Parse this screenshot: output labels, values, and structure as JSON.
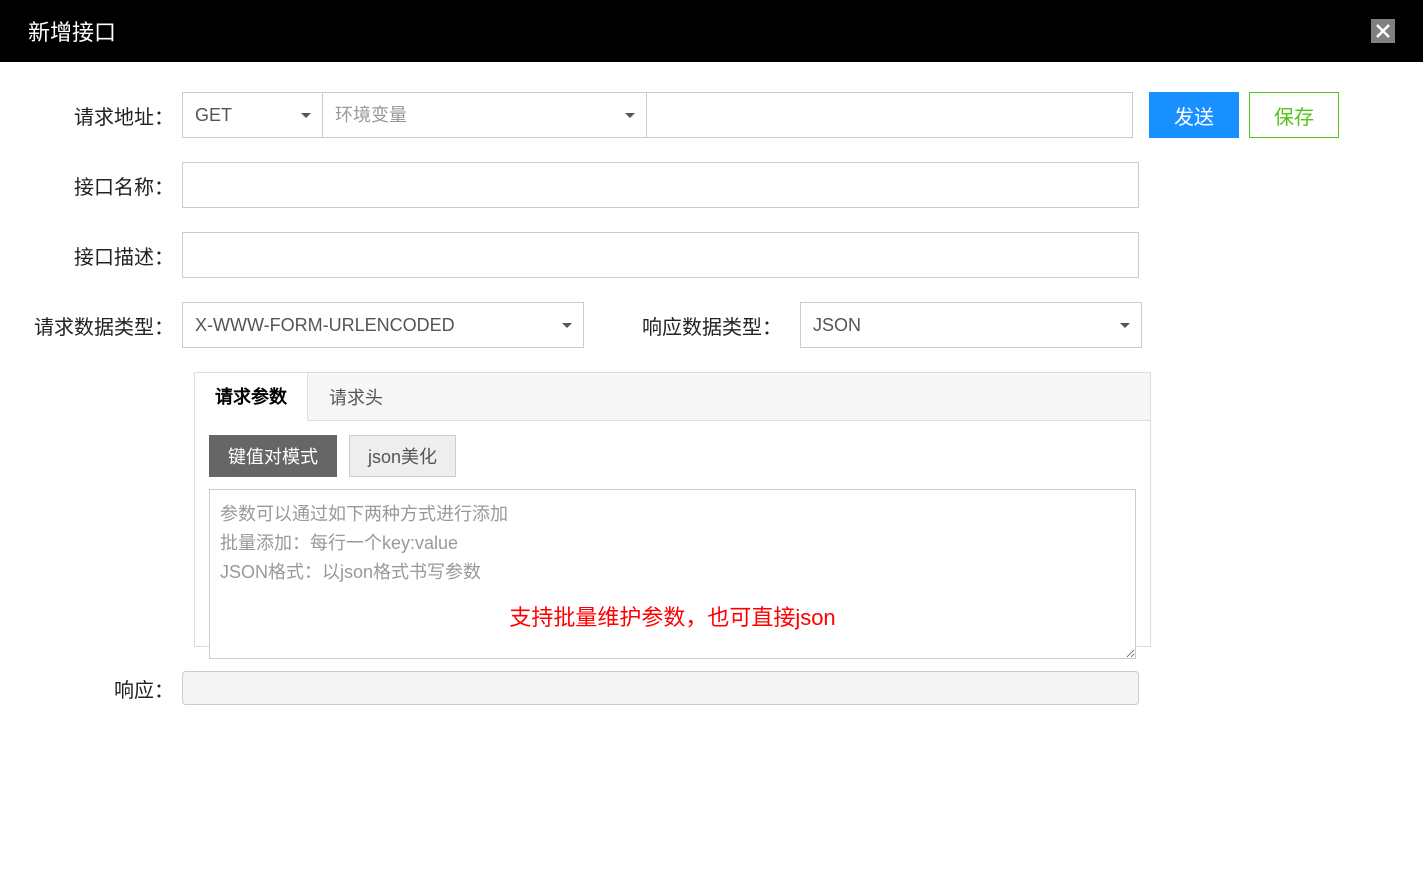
{
  "header": {
    "title": "新增接口"
  },
  "form": {
    "request_url_label": "请求地址：",
    "method_value": "GET",
    "env_placeholder": "环境变量",
    "url_value": "",
    "send_label": "发送",
    "save_label": "保存",
    "api_name_label": "接口名称：",
    "api_name_value": "",
    "api_desc_label": "接口描述：",
    "api_desc_value": "",
    "req_data_type_label": "请求数据类型：",
    "req_data_type_value": "X-WWW-FORM-URLENCODED",
    "res_data_type_label": "响应数据类型：",
    "res_data_type_value": "JSON"
  },
  "tabs": {
    "params_label": "请求参数",
    "headers_label": "请求头"
  },
  "param_modes": {
    "kv_label": "键值对模式",
    "json_beautify_label": "json美化"
  },
  "param_textarea": {
    "placeholder": "参数可以通过如下两种方式进行添加\n批量添加：每行一个key:value\nJSON格式：以json格式书写参数",
    "highlight": "支持批量维护参数，也可直接json"
  },
  "response": {
    "label": "响应："
  }
}
